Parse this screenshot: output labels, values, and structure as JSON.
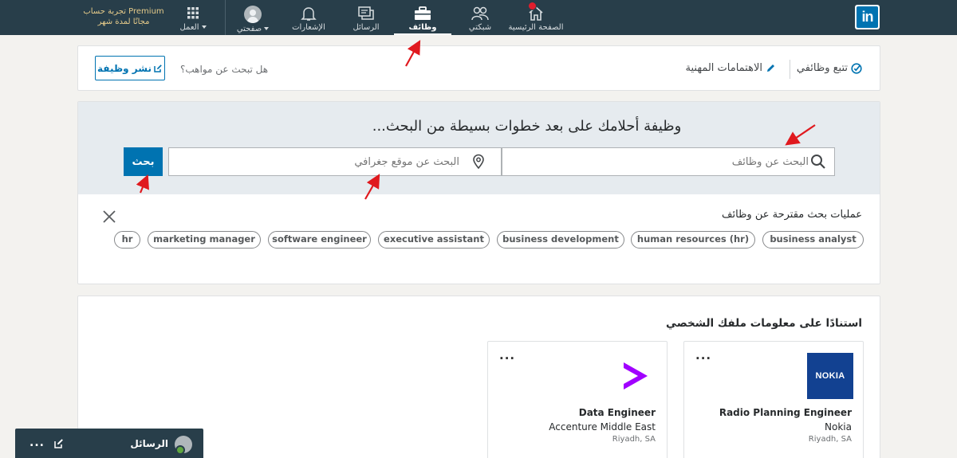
{
  "nav": {
    "logo_text": "in",
    "items": [
      {
        "label": "الصفحة الرئيسية",
        "icon": "home-icon",
        "has_badge": true
      },
      {
        "label": "شبكتي",
        "icon": "network-icon"
      },
      {
        "label": "وظائف",
        "icon": "briefcase-icon",
        "active": true
      },
      {
        "label": "الرسائل",
        "icon": "messaging-icon"
      },
      {
        "label": "الإشعارات",
        "icon": "bell-icon"
      },
      {
        "label": "صفحتي",
        "icon": "avatar-icon"
      },
      {
        "label": "العمل",
        "icon": "grid-icon"
      }
    ],
    "premium_line1": "تجربة حساب Premium",
    "premium_line2": "مجانًا لمدة شهر"
  },
  "subbar": {
    "tracked_jobs": "تتبع وظائفي",
    "career_interests": "الاهتمامات المهنية",
    "talent_question": "هل تبحث عن مواهب؟",
    "post_job": "نشر وظيفة"
  },
  "search": {
    "title": "وظيفة أحلامك على بعد خطوات بسيطة من البحث...",
    "keyword_placeholder": "البحث عن وظائف",
    "location_placeholder": "البحث عن موقع جغرافي",
    "button": "بحث",
    "suggestions_title": "عمليات بحث مقترحة عن وظائف",
    "suggestions": [
      "business analyst",
      "human resources (hr)",
      "business development",
      "executive assistant",
      "software engineer",
      "marketing manager",
      "hr"
    ]
  },
  "recommendations": {
    "title": "استنادًا على معلومات ملفك الشخصي",
    "jobs": [
      {
        "title": "Radio Planning Engineer",
        "company": "Nokia",
        "location": "Riyadh, SA",
        "logo_text": "NOKIA",
        "logo_color": "#124191"
      },
      {
        "title": "Data Engineer",
        "company": "Accenture Middle East",
        "location": "Riyadh, SA",
        "logo_color": "#a100ff"
      }
    ]
  },
  "messaging": {
    "label": "الرسائل"
  },
  "colors": {
    "nav_bg": "#283e4a",
    "brand_blue": "#0073b1",
    "annotation_red": "#e0191e"
  }
}
